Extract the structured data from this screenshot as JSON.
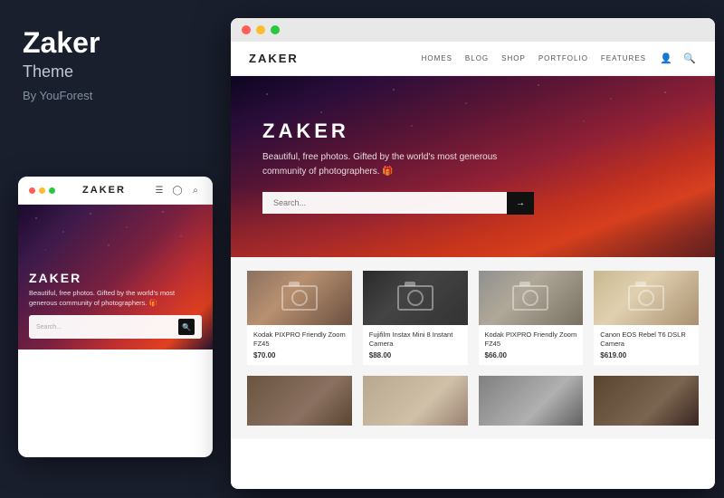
{
  "page": {
    "bg_color": "#1a1f2e"
  },
  "left": {
    "title": "Zaker",
    "subtitle": "Theme",
    "by_label": "By YouForest"
  },
  "mobile_preview": {
    "dots": [
      "red",
      "yellow",
      "green"
    ],
    "logo": "ZAKER",
    "hero_title": "ZAKER",
    "hero_text": "Beautiful, free photos. Gifted by the world's most generous community of photographers. 🎁",
    "search_placeholder": "Search...",
    "search_btn": "🔍"
  },
  "desktop_preview": {
    "dots": [
      "red",
      "yellow",
      "green"
    ],
    "nav": {
      "logo": "ZAKER",
      "links": [
        "HOMES",
        "BLOG",
        "SHOP",
        "PORTFOLIO",
        "FEATURES"
      ]
    },
    "hero": {
      "title": "ZAKER",
      "text": "Beautiful, free photos. Gifted by the world's most generous community of photographers. 🎁",
      "search_placeholder": "Search...",
      "search_btn": "→"
    },
    "products": [
      {
        "name": "Kodak PIXPRO Friendly Zoom FZ45",
        "price": "$70.00"
      },
      {
        "name": "Fujifilm Instax Mini 8 Instant Camera",
        "price": "$88.00"
      },
      {
        "name": "Kodak PIXPRO Friendly Zoom FZ45",
        "price": "$66.00"
      },
      {
        "name": "Canon EOS Rebel T6 DSLR Camera",
        "price": "$619.00"
      }
    ],
    "products_row2": [
      {
        "name": "",
        "price": ""
      },
      {
        "name": "",
        "price": ""
      },
      {
        "name": "",
        "price": ""
      },
      {
        "name": "",
        "price": ""
      }
    ]
  }
}
